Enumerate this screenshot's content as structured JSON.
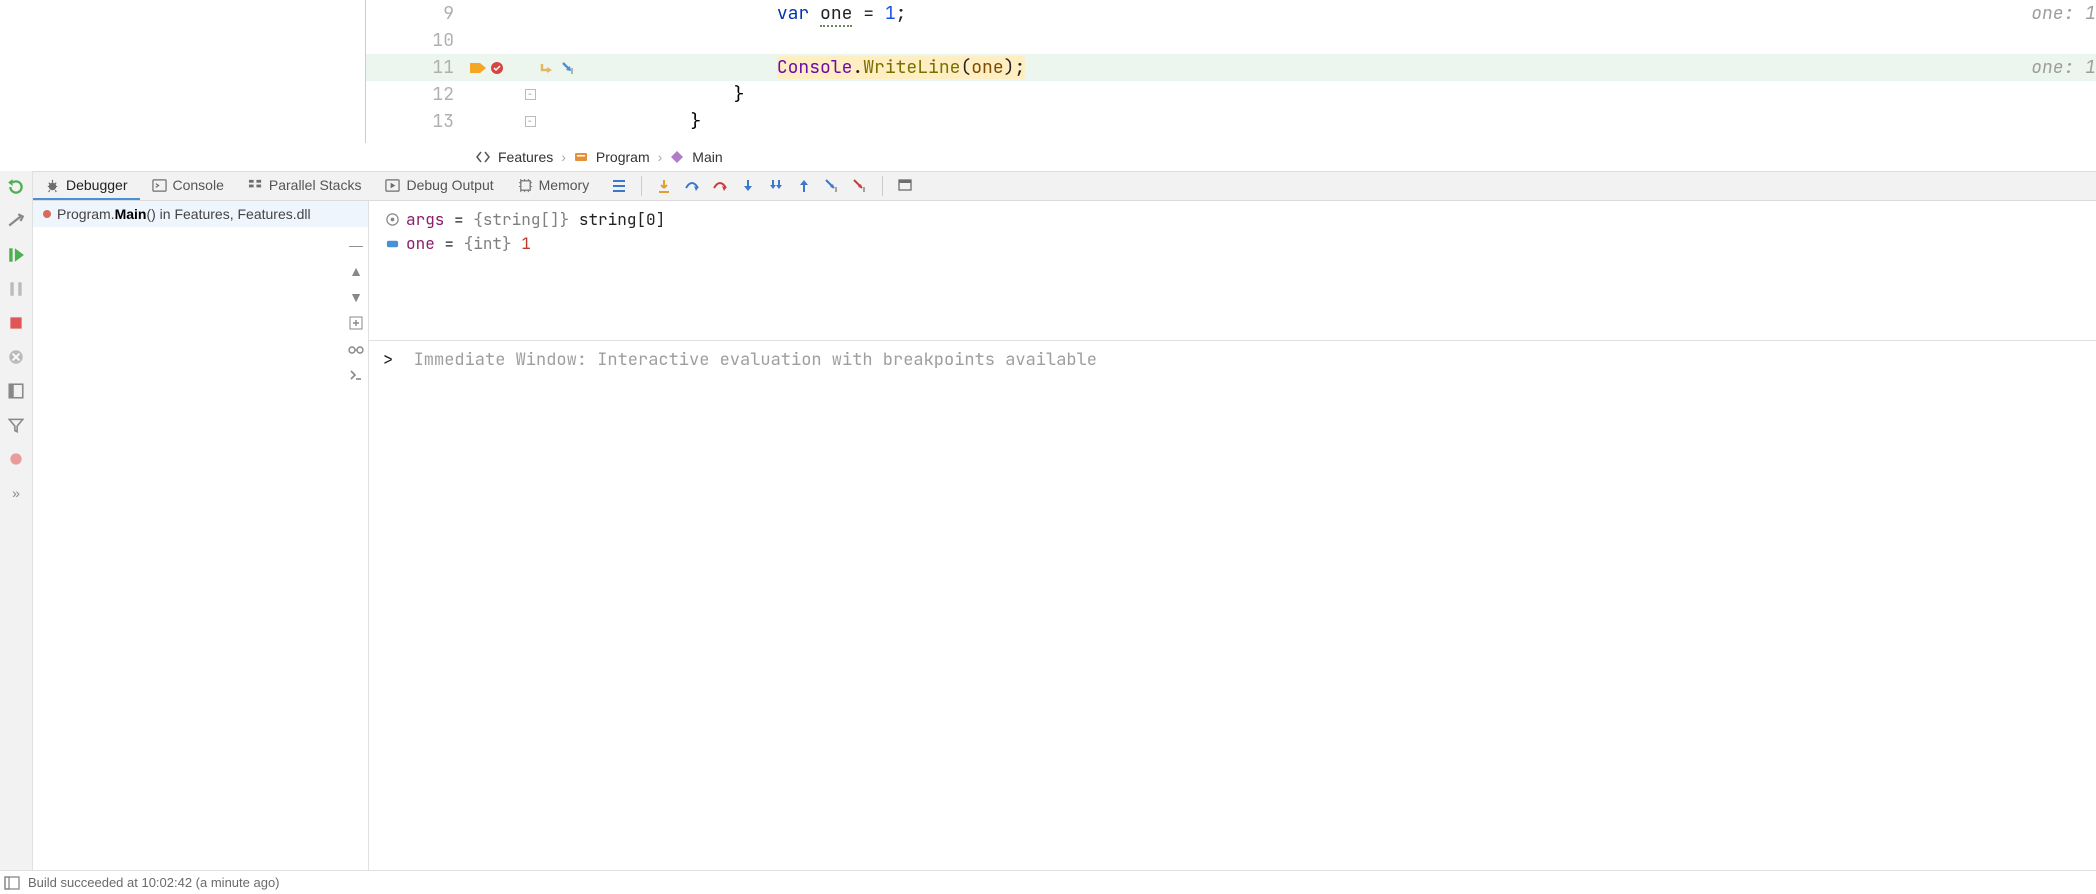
{
  "editor": {
    "lines": [
      {
        "num": "9",
        "current": false,
        "text_html": "                <span class='tok-kw'>var</span> <span class='tok-id'>one</span> = <span class='tok-num'>1</span>;",
        "inlay": "one: 1"
      },
      {
        "num": "10",
        "current": false,
        "text_html": "",
        "inlay": ""
      },
      {
        "num": "11",
        "current": true,
        "text_html": "                <span class='call-hl'><span class='tok-cls'>Console</span>.<span class='tok-mth'>WriteLine</span>(<span class='tok-var'>one</span>);</span>",
        "inlay": "one: 1"
      },
      {
        "num": "12",
        "current": false,
        "fold": true,
        "text_html": "            <span class='brace'>}</span>",
        "inlay": ""
      },
      {
        "num": "13",
        "current": false,
        "fold": true,
        "text_html": "        <span class='brace'>}</span>",
        "inlay": ""
      }
    ]
  },
  "breadcrumb": {
    "items": [
      "Features",
      "Program",
      "Main"
    ]
  },
  "debug_tabs": {
    "debugger": "Debugger",
    "console": "Console",
    "parallel": "Parallel Stacks",
    "output": "Debug Output",
    "memory": "Memory"
  },
  "frame": {
    "prefix": "Program.",
    "method": "Main",
    "suffix": "() in Features, Features.dll"
  },
  "vars": {
    "args": {
      "name": "args",
      "type": "{string[]}",
      "val": "string[0]"
    },
    "one": {
      "name": "one",
      "type": "{int}",
      "val": "1"
    }
  },
  "immediate": {
    "prompt": ">",
    "placeholder": "Immediate Window: Interactive evaluation with breakpoints available"
  },
  "status": {
    "text": "Build succeeded at 10:02:42 (a minute ago)"
  }
}
